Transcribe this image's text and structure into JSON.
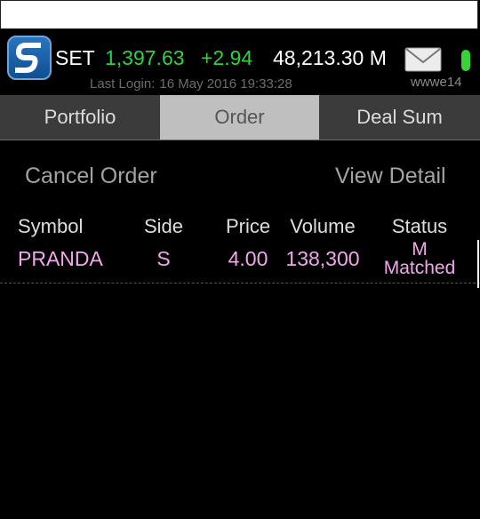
{
  "header": {
    "index_name": "SET",
    "index_value": "1,397.63",
    "index_change": "+2.94",
    "volume": "48,213.30 M",
    "last_login_label": "Last Login:",
    "last_login_time": "16 May 2016 19:33:28",
    "user": "wwwe14",
    "colors": {
      "up": "#31d23a",
      "logo": "#1b5ea8"
    }
  },
  "tabs": [
    {
      "label": "Portfolio"
    },
    {
      "label": "Order",
      "active": true
    },
    {
      "label": "Deal Sum"
    }
  ],
  "actions": {
    "cancel_label": "Cancel Order",
    "view_label": "View Detail"
  },
  "table": {
    "headers": [
      "Symbol",
      "Side",
      "Price",
      "Volume",
      "Status"
    ],
    "rows": [
      {
        "symbol": "PRANDA",
        "side": "S",
        "price": "4.00",
        "volume": "138,300",
        "status_code": "M",
        "status": "Matched"
      }
    ]
  }
}
